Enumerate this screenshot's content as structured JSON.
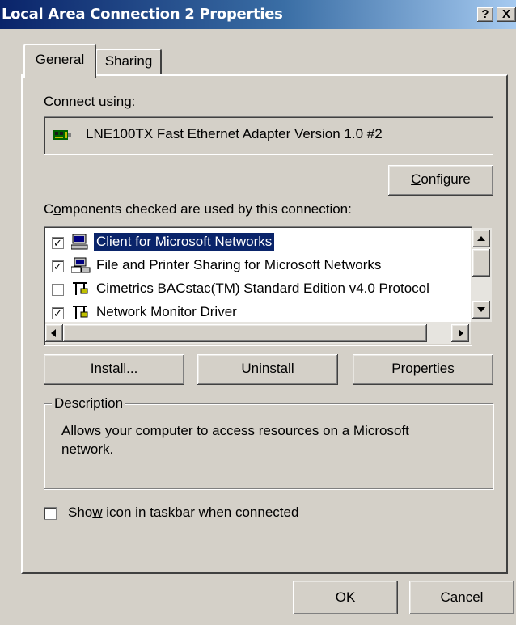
{
  "window": {
    "title": "Local Area Connection 2 Properties",
    "help_label": "?",
    "close_label": "X"
  },
  "tabs": [
    {
      "label": "General"
    },
    {
      "label": "Sharing"
    }
  ],
  "connect_using": {
    "label": "Connect using:",
    "adapter": "LNE100TX Fast Ethernet Adapter Version 1.0 #2"
  },
  "configure_button": {
    "prefix": "",
    "accel": "C",
    "rest": "onfigure"
  },
  "components": {
    "label_accel": "o",
    "label_prefix": "C",
    "label_rest": "mponents checked are used by this connection:",
    "items": [
      {
        "label": "Client for Microsoft Networks",
        "checked": true,
        "selected": true
      },
      {
        "label": "File and Printer Sharing for Microsoft Networks",
        "checked": true,
        "selected": false
      },
      {
        "label": "Cimetrics BACstac(TM) Standard Edition v4.0 Protocol",
        "checked": false,
        "selected": false
      },
      {
        "label": "Network Monitor Driver",
        "checked": true,
        "selected": false
      }
    ]
  },
  "buttons": {
    "install": {
      "accel": "I",
      "rest": "nstall..."
    },
    "uninstall": {
      "accel": "U",
      "rest": "ninstall"
    },
    "properties": {
      "prefix": "P",
      "accel": "r",
      "rest": "operties"
    }
  },
  "description": {
    "label": "Description",
    "text_line1": "Allows your computer to access resources on a Microsoft",
    "text_line2": "network."
  },
  "show_icon": {
    "prefix": "Sho",
    "accel": "w",
    "rest": " icon in taskbar when connected",
    "checked": false
  },
  "footer": {
    "ok": "OK",
    "cancel": "Cancel"
  },
  "colors": {
    "title_start": "#0a246a",
    "title_end": "#a6caf0",
    "face": "#d4d0c8",
    "selection": "#0a246a"
  }
}
